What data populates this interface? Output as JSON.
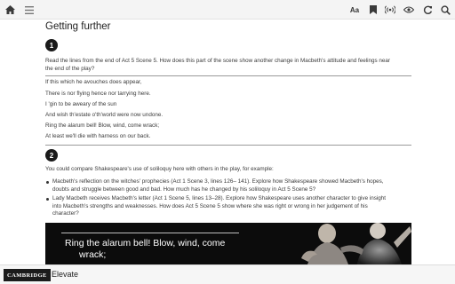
{
  "toolbar": {
    "left_icons": [
      "home-icon",
      "menu-icon"
    ],
    "font_label": "Aa",
    "right_icons": [
      "font-size-icon",
      "bookmark-icon",
      "audio-icon",
      "view-icon",
      "refresh-icon",
      "search-icon"
    ]
  },
  "content": {
    "title": "Getting further",
    "section1": {
      "number": "1",
      "question_line1": "Read the lines from the end of Act 5 Scene 5. How does this part of the scene show another change in Macbeth's attitude and feelings near",
      "question_line2": "the end of the play?",
      "poem": [
        "If this which he avouches does appear,",
        "There is nor flying hence nor tarrying here.",
        "I 'gin to be aweary of the sun",
        "And wish th'estate o'th'world were now undone.",
        "Ring the alarum bell! Blow, wind, come wrack;",
        "At least we'll die with harness on our back."
      ]
    },
    "section2": {
      "number": "2",
      "intro": "You could compare Shakespeare's use of soliloquy here with others in the play, for example:",
      "bullets": [
        {
          "line1": "Macbeth's reflection on the witches' prophecies (Act 1 Scene 3, lines 126– 141). Explore how Shakespeare showed Macbeth's hopes,",
          "line2": "doubts and struggle between good and bad. How much has he changed by his soliloquy in Act 5 Scene 5?"
        },
        {
          "line1": "Lady Macbeth receives Macbeth's letter (Act 1 Scene 5, lines 13–28). Explore how Shakespeare uses another character to give insight",
          "line2": "into Macbeth's strengths and weaknesses. How does Act 5 Scene 5 show where she was right or wrong in her judgement of his",
          "line3": "character?"
        }
      ]
    },
    "video": {
      "caption_line1": "Ring the alarum bell! Blow, wind, come",
      "caption_line2": "wrack;"
    }
  },
  "footer": {
    "publisher": "CAMBRIDGE",
    "product": "Elevate"
  }
}
